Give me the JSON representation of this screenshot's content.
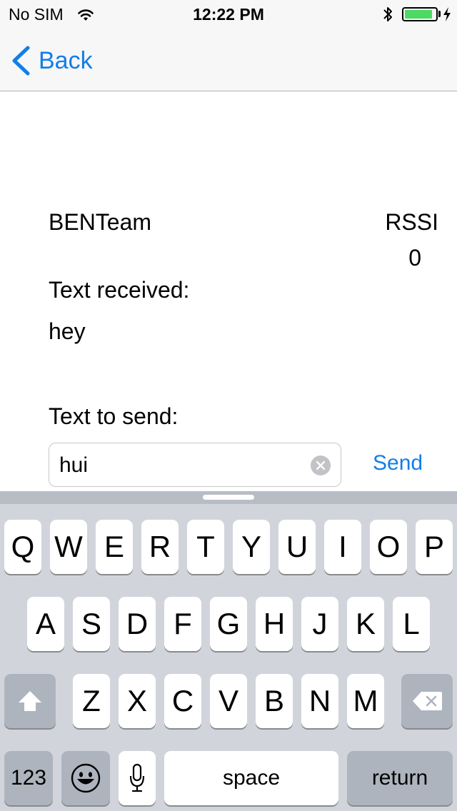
{
  "status_bar": {
    "carrier": "No SIM",
    "time": "12:22 PM",
    "battery_level": 0.9,
    "icons": [
      "wifi-icon",
      "bluetooth-icon",
      "battery-icon",
      "charging-icon"
    ],
    "battery_color": "#4cd964"
  },
  "nav": {
    "back_label": "Back",
    "accent_color": "#137ee6"
  },
  "device": {
    "name": "BENTeam",
    "rssi_label": "RSSI",
    "rssi_value": "0"
  },
  "received": {
    "label": "Text received:",
    "text": "hey"
  },
  "send": {
    "label": "Text to send:",
    "value": "hui",
    "button_label": "Send"
  },
  "keyboard": {
    "row1": [
      "Q",
      "W",
      "E",
      "R",
      "T",
      "Y",
      "U",
      "I",
      "O",
      "P"
    ],
    "row2": [
      "A",
      "S",
      "D",
      "F",
      "G",
      "H",
      "J",
      "K",
      "L"
    ],
    "row3": [
      "Z",
      "X",
      "C",
      "V",
      "B",
      "N",
      "M"
    ],
    "numbers_label": "123",
    "space_label": "space",
    "return_label": "return",
    "icons": [
      "shift-icon",
      "delete-icon",
      "emoji-icon",
      "microphone-icon"
    ]
  }
}
